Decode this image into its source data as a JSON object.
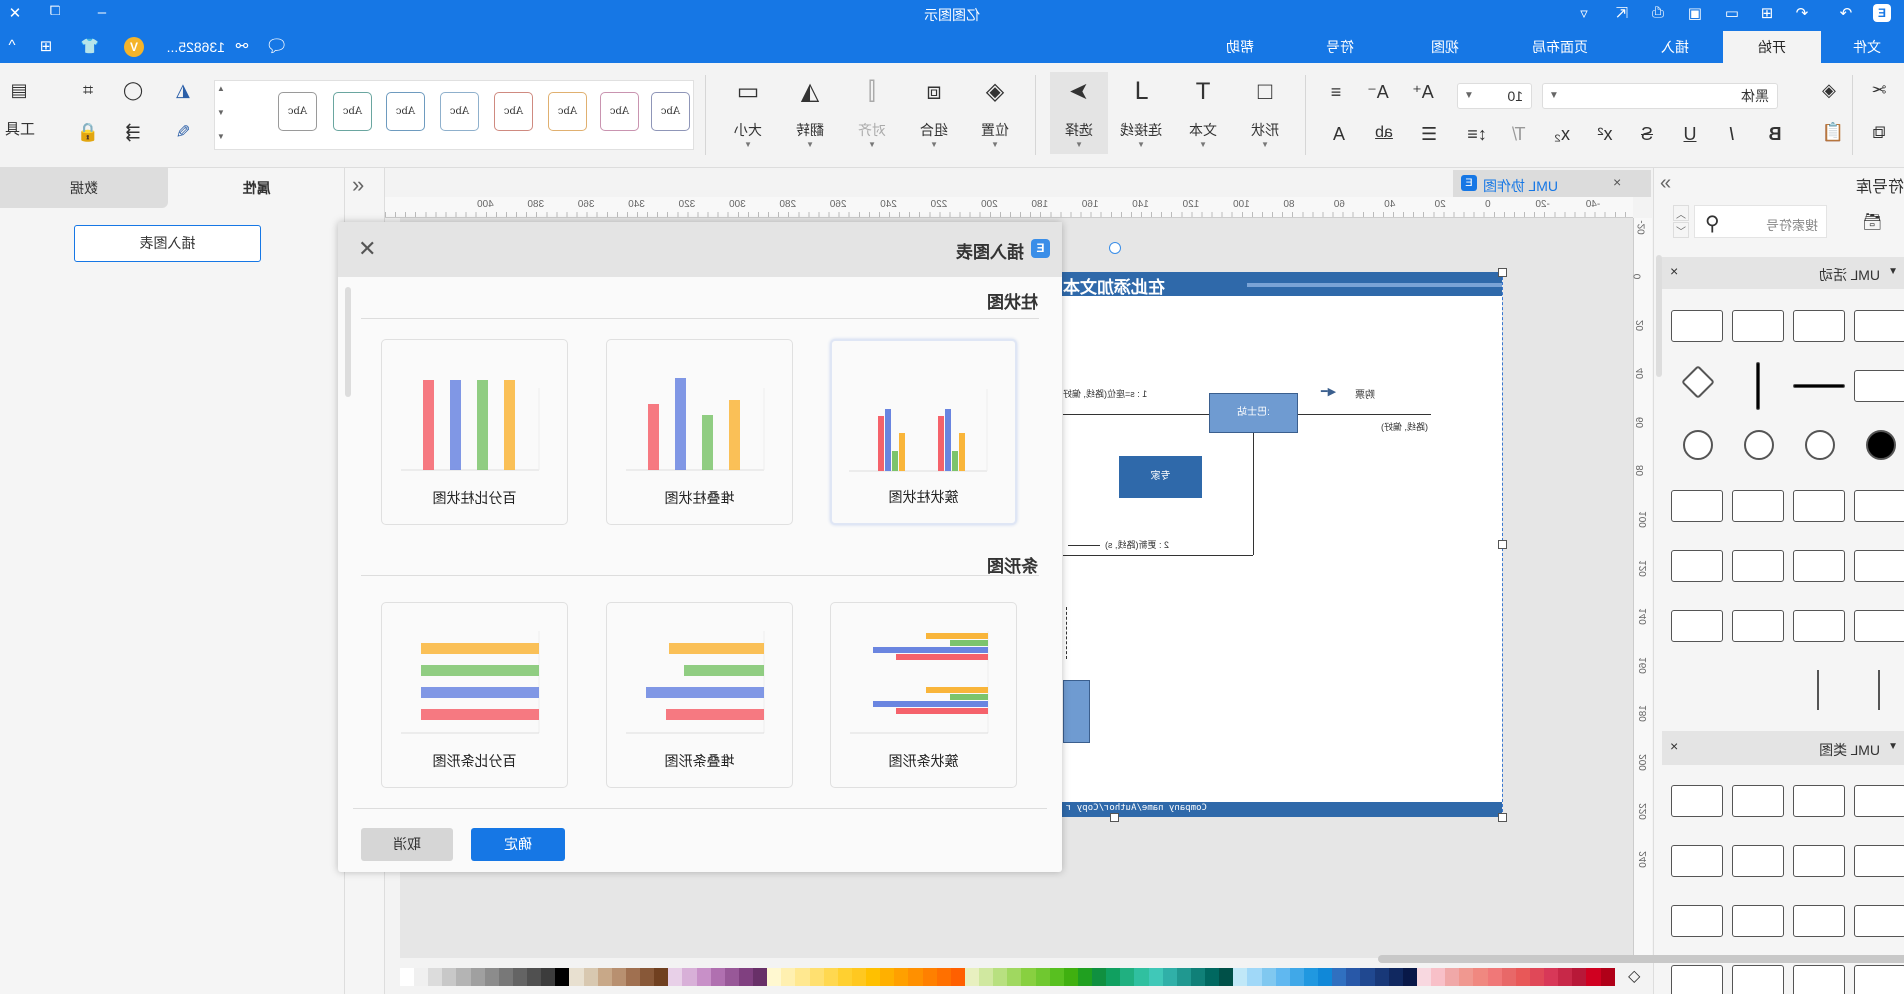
{
  "app": {
    "title": "亿图图示",
    "user": "136825...",
    "badge": "V"
  },
  "menu_tabs": [
    {
      "label": "文件"
    },
    {
      "label": "开始",
      "active": true
    },
    {
      "label": "插入"
    },
    {
      "label": "页面布局"
    },
    {
      "label": "视图"
    },
    {
      "label": "符号"
    },
    {
      "label": "帮助"
    }
  ],
  "ribbon": {
    "font_family": "黑体",
    "font_size": "10",
    "big_buttons": [
      {
        "label": "形状",
        "icon": "square-icon"
      },
      {
        "label": "文本",
        "icon": "text-icon"
      },
      {
        "label": "连接线",
        "icon": "connector-icon"
      },
      {
        "label": "选择",
        "icon": "pointer-icon"
      },
      {
        "label": "位置",
        "icon": "layers-icon"
      },
      {
        "label": "组合",
        "icon": "group-icon"
      },
      {
        "label": "对齐",
        "icon": "align-icon"
      },
      {
        "label": "翻转",
        "icon": "flip-icon"
      },
      {
        "label": "大小",
        "icon": "size-icon"
      }
    ],
    "tools_label": "工具",
    "style_swatch_label": "Abc",
    "style_swatch_colors": [
      "#9a9a9a",
      "#6aa6a0",
      "#6e9bbf",
      "#8fb0cc",
      "#cf8a80",
      "#e0b070",
      "#c994b0",
      "#8f96b8"
    ]
  },
  "left_panel": {
    "tabs": [
      {
        "label": "属性",
        "active": true
      },
      {
        "label": "数据"
      }
    ],
    "insert_chart_button": "插入图表"
  },
  "dialog": {
    "title": "插入图表",
    "sections": [
      {
        "heading": "柱状图",
        "items": [
          {
            "label": "簇状柱状图",
            "type": "clustered-column",
            "selected": true
          },
          {
            "label": "堆叠柱状图",
            "type": "stacked-column"
          },
          {
            "label": "百分比柱状图",
            "type": "percent-column"
          }
        ]
      },
      {
        "heading": "条形图",
        "items": [
          {
            "label": "簇状条形图",
            "type": "clustered-bar"
          },
          {
            "label": "堆叠条形图",
            "type": "stacked-bar"
          },
          {
            "label": "百分比条形图",
            "type": "percent-bar"
          }
        ]
      }
    ],
    "ok": "确定",
    "cancel": "取消"
  },
  "document_tab": {
    "label": "UML 协作图"
  },
  "canvas": {
    "header_text": "在此添加文本",
    "footer_text": "Company name/Author/Copy r",
    "nodes": {
      "station": ":巴士站",
      "expert": "专家"
    },
    "labels": {
      "buy": "购票",
      "buy_args": "(路线, 偏好)",
      "msg1": "1 : s=座位(路线, 偏好",
      "msg2": "2 : 更新(路线, s)"
    }
  },
  "rulers": {
    "top": [
      -40,
      -20,
      0,
      20,
      40,
      60,
      80,
      100,
      120,
      140,
      160,
      180,
      200,
      220,
      240,
      260,
      280,
      300,
      320,
      340,
      360,
      380,
      400
    ],
    "side": [
      -20,
      0,
      20,
      40,
      60,
      80,
      100,
      120,
      140,
      160,
      180,
      200,
      220,
      240
    ]
  },
  "library": {
    "title": "符号库",
    "search_placeholder": "搜索符号",
    "sections": [
      {
        "title": "UML 活动"
      },
      {
        "title": "UML 类图"
      }
    ]
  },
  "palette": [
    "#ffffff",
    "#f0f0f0",
    "#dcdcdc",
    "#c8c8c8",
    "#b4b4b4",
    "#a0a0a0",
    "#8c8c8c",
    "#787878",
    "#646464",
    "#505050",
    "#3c3c3c",
    "#000000",
    "#e8e0d0",
    "#d8c8b0",
    "#c8a888",
    "#b89070",
    "#a07050",
    "#885838",
    "#704020",
    "#e8d0e8",
    "#d8b0d8",
    "#c890c8",
    "#b070b0",
    "#985898",
    "#804080",
    "#683068",
    "#fff8d0",
    "#fff0b0",
    "#ffe890",
    "#ffe070",
    "#ffd850",
    "#ffd030",
    "#ffc820",
    "#ffc000",
    "#ffb000",
    "#ffa000",
    "#ff9000",
    "#ff8000",
    "#ff7000",
    "#ff6000",
    "#e8f0c0",
    "#d0e8a0",
    "#b8e080",
    "#a0d860",
    "#88d040",
    "#70c830",
    "#58c020",
    "#40b010",
    "#20a020",
    "#109040",
    "#10a060",
    "#20b080",
    "#30c0a0",
    "#40c8b8",
    "#30b0a8",
    "#209890",
    "#108078",
    "#006860",
    "#005048",
    "#c0e8f8",
    "#a0d8f8",
    "#80c8f0",
    "#60b8f0",
    "#40a8e8",
    "#2098e0",
    "#1088d8",
    "#3070c0",
    "#2858a8",
    "#204890",
    "#183878",
    "#102860",
    "#081848",
    "#f8d8e0",
    "#f8c0c8",
    "#f0a8a8",
    "#f09890",
    "#f08880",
    "#f07878",
    "#e86868",
    "#e85858",
    "#e04858",
    "#d83858",
    "#c82848",
    "#b81838",
    "#d00020",
    "#b00018"
  ]
}
